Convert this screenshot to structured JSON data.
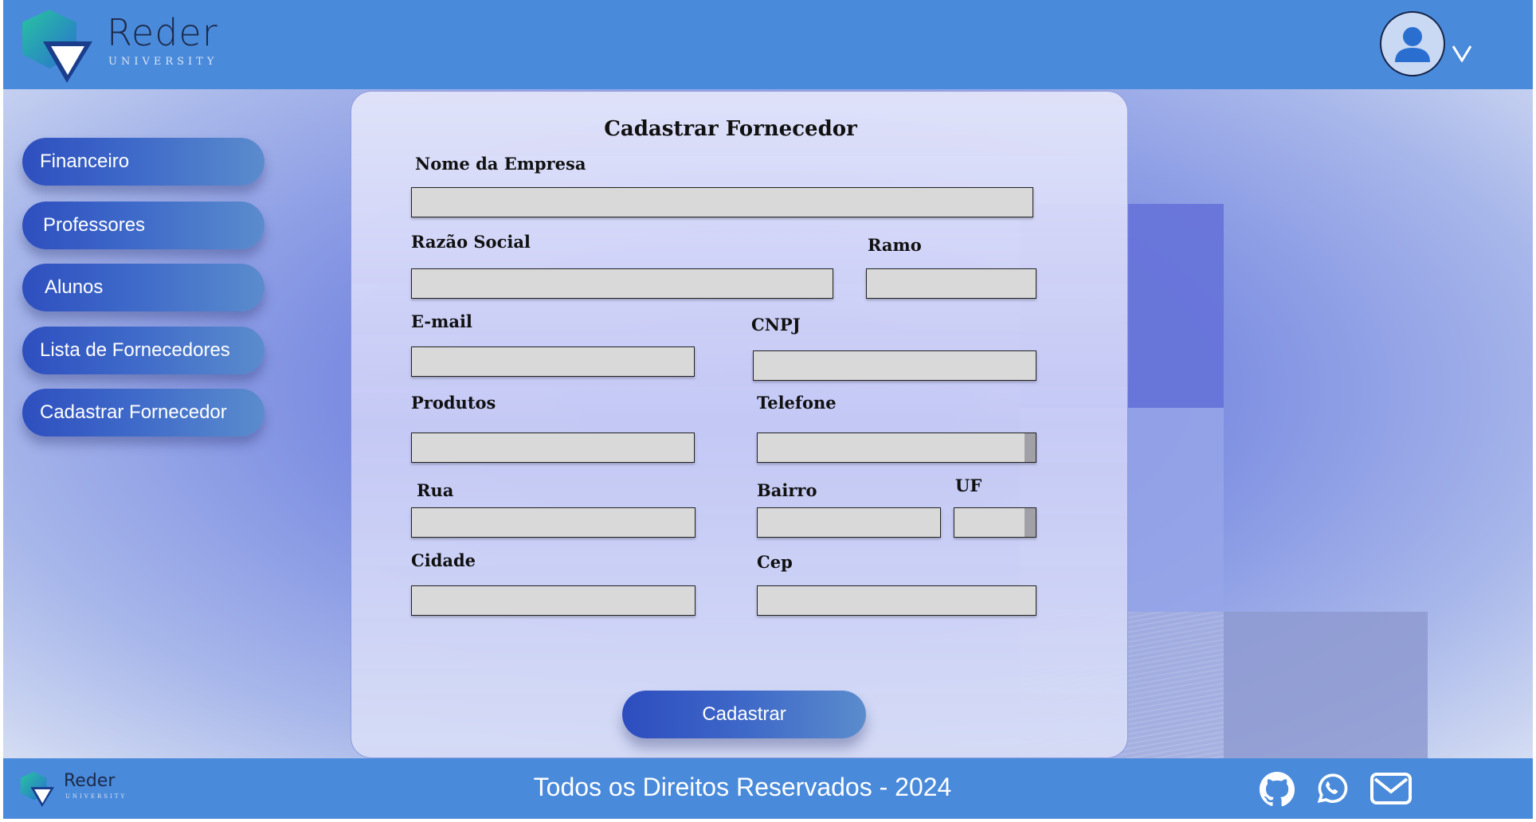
{
  "brand": {
    "name": "Reder",
    "tagline": "UNIVERSITY"
  },
  "sidebar": {
    "items": [
      {
        "label": "Financeiro"
      },
      {
        "label": "Professores"
      },
      {
        "label": "Alunos"
      },
      {
        "label": "Lista de Fornecedores"
      },
      {
        "label": "Cadastrar Fornecedor"
      }
    ]
  },
  "form": {
    "title": "Cadastrar Fornecedor",
    "fields": {
      "nome_empresa": {
        "label": "Nome da Empresa",
        "value": ""
      },
      "razao_social": {
        "label": "Razão Social",
        "value": ""
      },
      "ramo": {
        "label": "Ramo",
        "value": ""
      },
      "email": {
        "label": "E-mail",
        "value": ""
      },
      "cnpj": {
        "label": "CNPJ",
        "value": ""
      },
      "produtos": {
        "label": "Produtos",
        "value": ""
      },
      "telefone": {
        "label": "Telefone",
        "value": ""
      },
      "rua": {
        "label": "Rua",
        "value": ""
      },
      "bairro": {
        "label": "Bairro",
        "value": ""
      },
      "uf": {
        "label": "UF",
        "value": ""
      },
      "cidade": {
        "label": "Cidade",
        "value": ""
      },
      "cep": {
        "label": "Cep",
        "value": ""
      }
    },
    "submit_label": "Cadastrar"
  },
  "footer": {
    "text": "Todos os Direitos Reservados - 2024",
    "icons": [
      "github-icon",
      "whatsapp-icon",
      "email-icon"
    ]
  },
  "colors": {
    "header": "#4a8adb",
    "nav_button": "#2e4fbf",
    "field_bg": "#d9d9d9"
  }
}
